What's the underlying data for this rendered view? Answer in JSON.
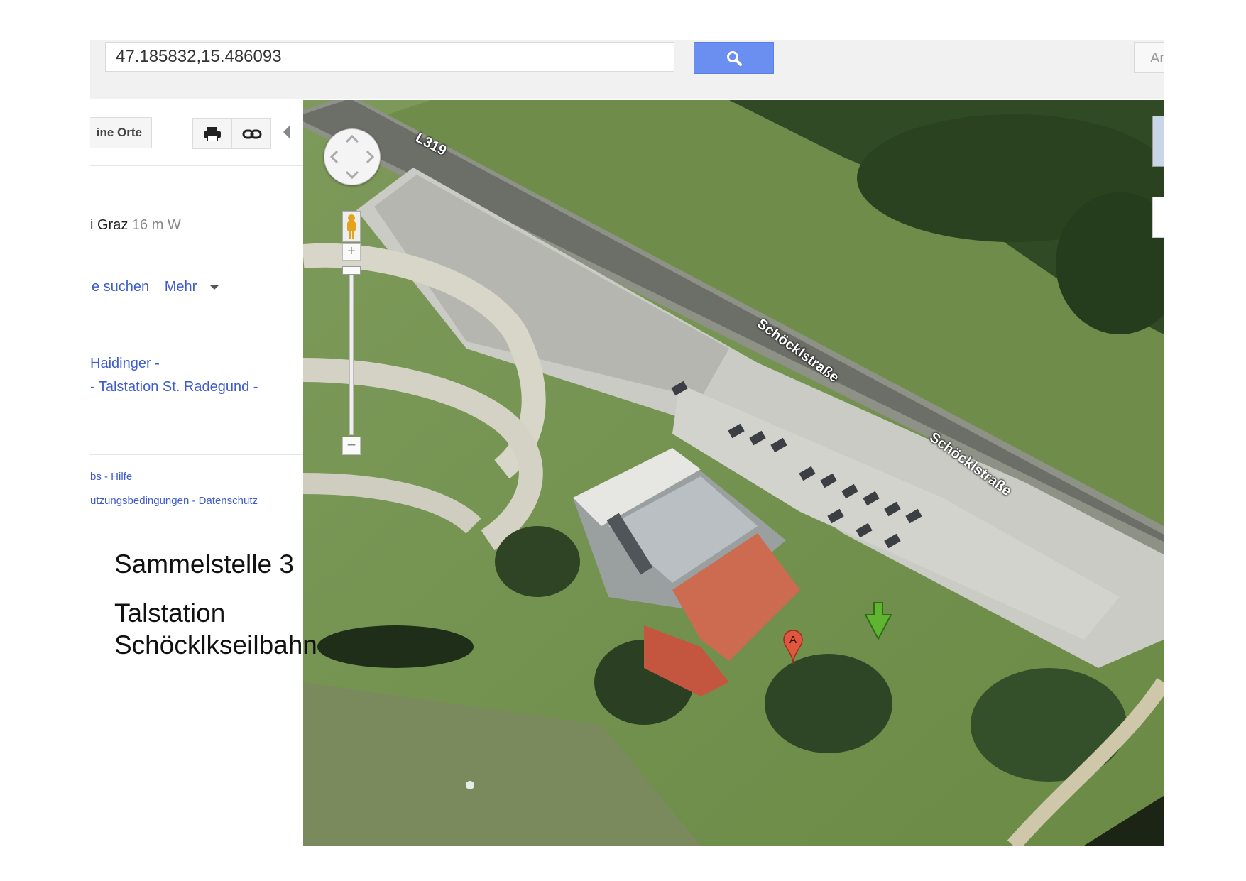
{
  "search": {
    "query": "47.185832,15.486093",
    "button_icon": "search-icon",
    "right_button_label": "An"
  },
  "left_panel": {
    "my_places_label": "ine Orte",
    "print_icon": "print-icon",
    "link_icon": "link-icon",
    "location_name": "i Graz",
    "location_distance": "16 m W",
    "action_search": "e suchen",
    "action_more": "Mehr",
    "link_line1": "Haidinger -",
    "link_line2": "- Talstation St. Radegund -",
    "footer_line1": "bs - Hilfe",
    "footer_line2": "utzungsbedingungen - Datenschutz"
  },
  "annotation": {
    "line1": "Sammelstelle 3",
    "line2": "Talstation",
    "line3": "Schöcklkseilbahn"
  },
  "map": {
    "road_l319": "L319",
    "road_schocklstrasse_1": "Schöcklstraße",
    "road_schocklstrasse_2": "Schöcklstraße",
    "marker_a_label": "A",
    "marker_a_color": "#e0573f",
    "arrow_marker_color": "#5fb531",
    "zoom_in_label": "+",
    "zoom_out_label": "−"
  },
  "colors": {
    "search_button": "#6b8ff0",
    "link": "#3e5ccf"
  }
}
